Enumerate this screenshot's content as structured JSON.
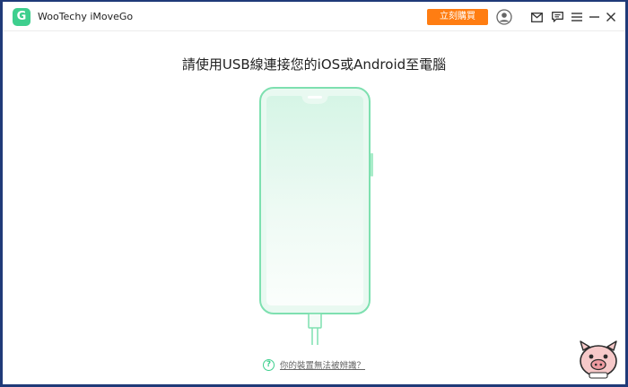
{
  "app": {
    "logo_letter": "G",
    "name": "WooTechy iMoveGo",
    "buy_label": "立刻購買"
  },
  "titlebar": {
    "icons": [
      "account-icon",
      "mail-icon",
      "feedback-icon",
      "menu-icon",
      "minimize-icon",
      "close-icon"
    ]
  },
  "main": {
    "headline": "請使用USB線連接您的iOS或Android至電腦",
    "help_icon": "?",
    "help_link": "你的裝置無法被辨識？"
  },
  "colors": {
    "accent": "#3ecf8e",
    "buy_button": "#ff7d12",
    "phone_outline": "#7ee0b0"
  }
}
